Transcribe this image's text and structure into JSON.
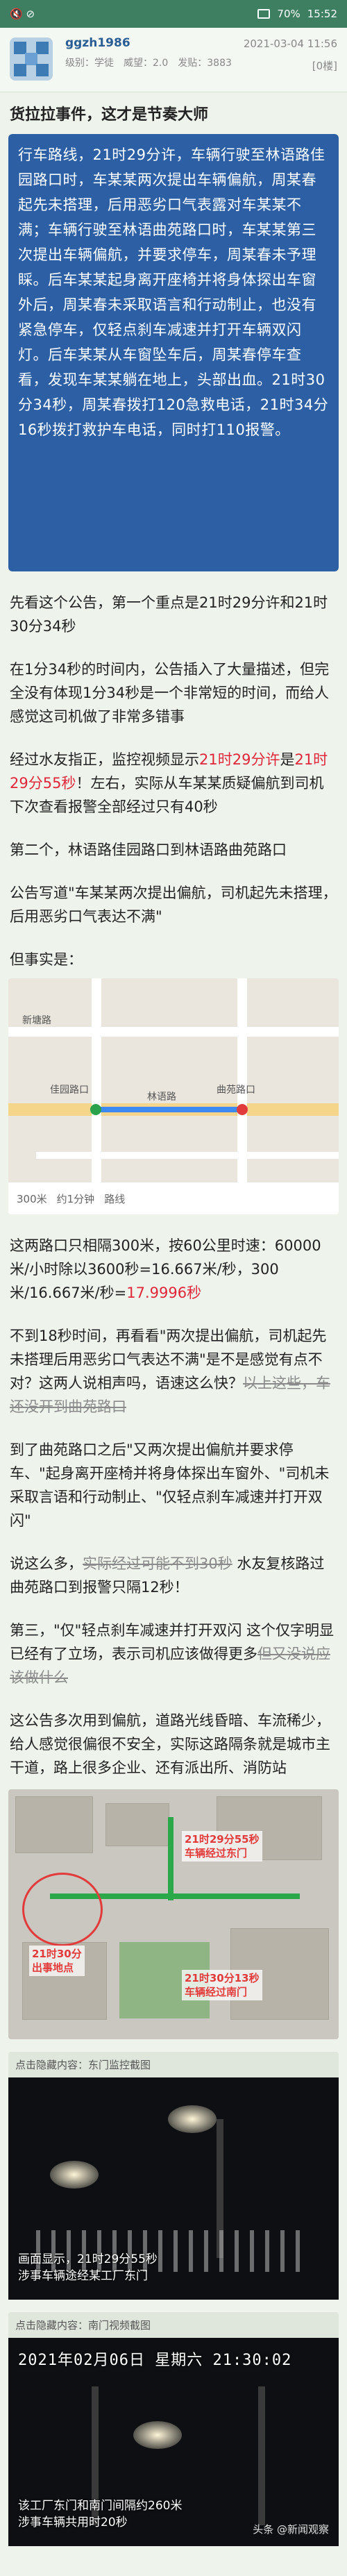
{
  "status": {
    "left": "🔇 ⊘",
    "battery": "70%",
    "time": "15:52"
  },
  "post": {
    "username": "ggzh1986",
    "date": "2021-03-04 11:56",
    "level": "级别：学徒",
    "prestige": "威望：2.0",
    "posts": "发贴：3883",
    "fav": "[0楼]"
  },
  "title": "货拉拉事件，这才是节奏大师",
  "notice": [
    "行车路线，21时29分许，车辆行驶至林语路佳园路口时，车某某两次提出车辆偏航，周某春起先未搭理，后用恶劣口气表露对车某某不满；车辆行驶至林语曲苑路口时，车某某第三次提出车辆偏航，并要求停车，周某春未予理睬。后车某某起身离开座椅并将身体探出车窗外后，周某春未采取语言和行动制止，也没有紧急停车，仅轻点刹车减速并打开车辆双闪灯。后车某某从车窗坠车后，周某春停车查看，发现车某某躺在地上，头部出血。21时30分34秒，周某春拨打120急救电话，21时34分16秒拨打救护车电话，同时打110报警。"
  ],
  "paragraphs": {
    "p1": "先看这个公告，第一个重点是21时29分许和21时30分34秒",
    "p2": "在1分34秒的时间内，公告插入了大量描述，但完全没有体现1分34秒是一个非常短的时间，而给人感觉这司机做了非常多错事",
    "p3a": "经过水友指正，监控视频显示",
    "p3red1": "21时29分许",
    "p3b": "是",
    "p3red2": "21时29分55秒",
    "p3c": "！左右，实际从车某某质疑偏航到司机下次查看报警全部经过只有40秒",
    "p4": "第二个，林语路佳园路口到林语路曲苑路口",
    "p5": "公告写道\"车某某两次提出偏航，司机起先未搭理，后用恶劣口气表达不满\"",
    "p6": "但事实是：",
    "p7a": "这两路口只相隔300米，按60公里时速：60000米/小时除以3600秒=16.667米/秒，300米/16.667米/秒=",
    "p7red": "17.9996秒",
    "p8a": "不到18秒时间，再看看\"两次提出偏航，司机起先未搭理后用恶劣口气表达不满\"是不是感觉有点不对？这两人说相声吗，语速这么快？",
    "p8strike": "以上这些，车还没开到曲苑路口",
    "p9": "到了曲苑路口之后\"又两次提出偏航并要求停车、\"起身离开座椅并将身体探出车窗外、\"司机未采取言语和行动制止、\"仅轻点刹车减速并打开双闪\"",
    "p10a": "说这么多，",
    "p10strike": "实际经过可能不到30秒",
    "p10b": " 水友复核路过曲苑路口到报警只隔12秒！",
    "p11a": "第三，\"仅\"轻点刹车减速并打开双闪 这个仅字明显已经有了立场，表示司机应该做得更多",
    "p11strike": "但又没说应该做什么",
    "p12": "这公告多次用到偏航，道路光线昏暗、车流稀少，给人感觉很偏很不安全，实际这路隔条就是城市主干道，路上很多企业、还有派出所、消防站"
  },
  "map1": {
    "labels": [
      "佳园路口",
      "林语路",
      "曲苑路口",
      "新塘路"
    ],
    "bottom": [
      "300米",
      "约1分钟",
      "路线"
    ]
  },
  "map2": {
    "tag1": "21时29分55秒\n车辆经过东门",
    "tag2": "21时30分13秒\n车辆经过南门",
    "tag3": "21时30分\n出事地点"
  },
  "captions": {
    "cap1": "点击隐藏内容：东门监控截图",
    "cap2": "点击隐藏内容：南门视频截图"
  },
  "cctv1": {
    "subtitle": "画面显示，21时29分55秒\n涉事车辆途经某工厂东门"
  },
  "cctv2": {
    "timestamp": "2021年02月06日 星期六 21:30:02",
    "subtitle": "该工厂东门和南门间隔约260米\n涉事车辆共用时20秒"
  },
  "watermark": "头条 @新闻观察"
}
